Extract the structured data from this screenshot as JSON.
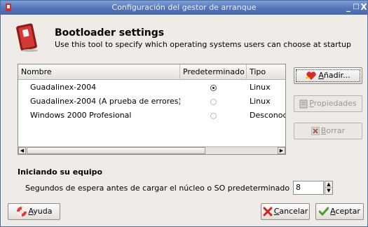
{
  "window": {
    "title": "Configuración del gestor de arranque",
    "controls": [
      "_",
      "□",
      "X"
    ]
  },
  "header": {
    "title": "Bootloader settings",
    "subtitle": "Use this tool to specify which operating systems users can choose at startup"
  },
  "list": {
    "columns": [
      "Nombre",
      "Predeterminado",
      "Tipo"
    ],
    "rows": [
      {
        "name": "Guadalinex-2004",
        "default": true,
        "type": "Linux"
      },
      {
        "name": "Guadalinex-2004 (A prueba de errores)",
        "default": false,
        "type": "Linux"
      },
      {
        "name": "Windows 2000 Profesional",
        "default": false,
        "type": "Desconoc"
      }
    ]
  },
  "side_buttons": {
    "add": {
      "prefix": "",
      "mnemonic": "A",
      "rest": "ñadir...",
      "enabled": true
    },
    "properties": {
      "prefix": "",
      "mnemonic": "P",
      "rest": "ropiedades",
      "enabled": false
    },
    "delete": {
      "prefix": "",
      "mnemonic": "B",
      "rest": "orrar",
      "enabled": false
    }
  },
  "startup": {
    "section_title": "Iniciando su equipo",
    "timeout_label": "Segundos de espera antes de cargar el núcleo o SO predeterminado",
    "timeout_value": "8"
  },
  "footer": {
    "help": {
      "mnemonic": "A",
      "rest": "yuda"
    },
    "cancel": {
      "mnemonic": "C",
      "rest": "ancelar"
    },
    "ok": {
      "mnemonic": "A",
      "rest": "ceptar"
    }
  },
  "colors": {
    "titlebar": "#5575b9",
    "window_bg": "#efebe7",
    "disabled_text": "#9a9794"
  },
  "icons": {
    "app": "app-icon",
    "header": "switch-icon",
    "add": "heart-add-icon",
    "properties": "properties-icon",
    "delete": "delete-x-icon",
    "help": "lifebuoy-icon",
    "cancel": "cancel-x-icon",
    "ok": "checkmark-icon"
  }
}
